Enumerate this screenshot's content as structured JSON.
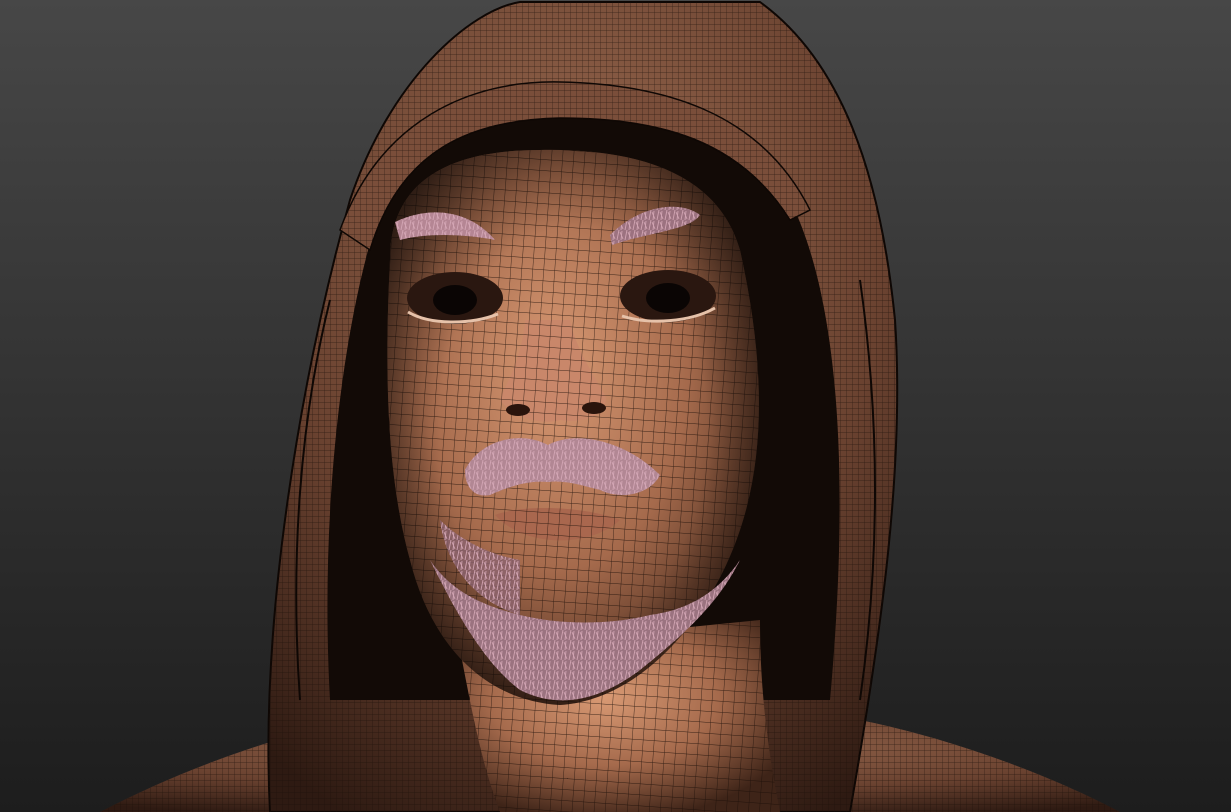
{
  "app": {
    "name": "3d-viewport",
    "view": "perspective",
    "shading": "wireframe-on-shaded",
    "subject": "hooded-bearded-head-model"
  },
  "colors": {
    "background_top": "#464646",
    "background_bottom": "#1e1e1e",
    "skin": "#c58a68",
    "skin_shadow": "#5a3624",
    "hood": "#8a5c44",
    "hood_shadow": "#3a2218",
    "wire": "#1a0e08",
    "hair": "#c79aa8",
    "viewport_border": "#6a7fa0"
  },
  "icons": {
    "viewport": "3d-viewport-icon"
  }
}
